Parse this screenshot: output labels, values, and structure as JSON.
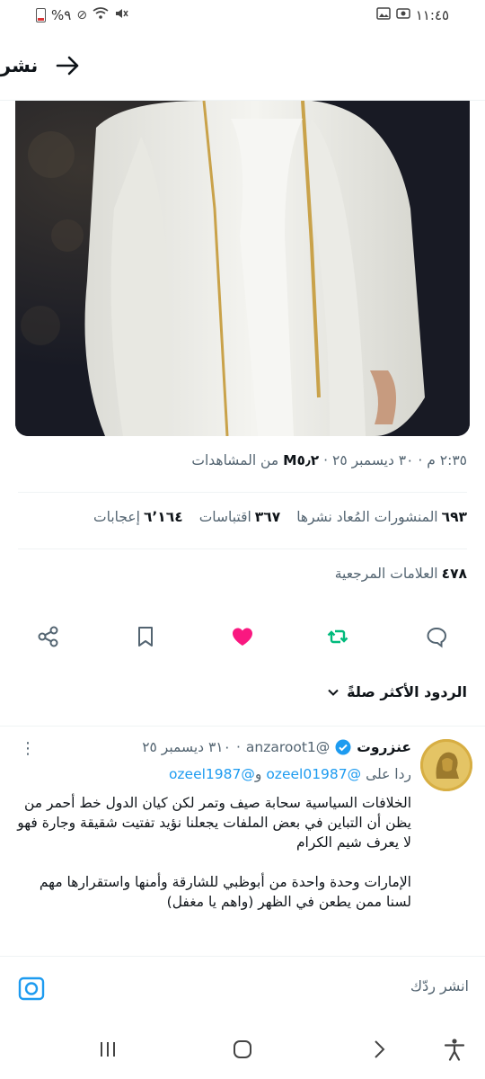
{
  "status_bar": {
    "time": "١١:٤٥",
    "battery_text": "%٩"
  },
  "header": {
    "title": "نشر"
  },
  "post_meta": {
    "time": "٢:٣٥ م",
    "separator": "·",
    "date": "٣٠ ديسمبر ٢٥",
    "views_count": "M٥٫٢",
    "views_label": "من المشاهدات"
  },
  "stats": {
    "reposts_count": "٦٩٣",
    "reposts_label": "المنشورات المُعاد نشرها",
    "quotes_count": "٣٦٧",
    "quotes_label": "اقتباسات",
    "likes_count": "٦٬١٦٤",
    "likes_label": "إعجابات",
    "bookmarks_count": "٤٧٨",
    "bookmarks_label": "العلامات المرجعية"
  },
  "actions": [
    "reply-icon",
    "repost-icon",
    "like-icon",
    "bookmark-icon",
    "share-icon"
  ],
  "colors": {
    "like": "#f91880",
    "repost": "#00ba7c",
    "link": "#1d9bf0",
    "muted": "#536471"
  },
  "sort": {
    "label": "الردود الأكثر صلةً"
  },
  "reply": {
    "name": "عنزروت",
    "handle": "@anzaroot1",
    "separator": "·",
    "date": "٣١٠ ديسمبر ٢٥",
    "replying_to_label": "ردا على",
    "mention_1": "@ozeel01987",
    "and": "و",
    "mention_2": "@ozeel1987",
    "text": "الخلافات السياسية سحابة صيف وتمر لكن كيان الدول خط أحمر من يظن أن التباين في بعض الملفات يجعلنا نؤيد تفتيت شقيقة وجارة فهو لا يعرف شيم الكرام\n\nالإمارات وحدة واحدة من أبوظبي للشارقة وأمنها واستقرارها مهم لسنا ممن يطعن في الظهر (واهم يا مغفل)"
  },
  "composer": {
    "placeholder": "انشر ردّك"
  }
}
